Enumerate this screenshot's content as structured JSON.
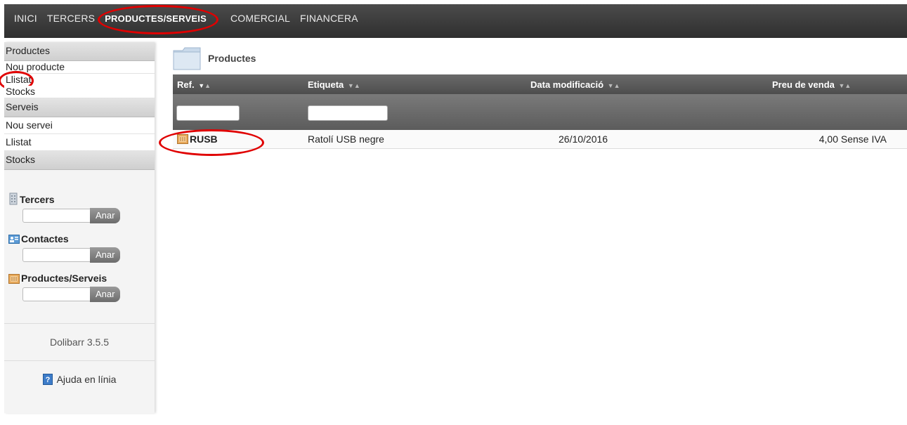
{
  "topmenu": {
    "items": [
      {
        "label": "INICI"
      },
      {
        "label": "TERCERS"
      },
      {
        "label": "PRODUCTES/SERVEIS"
      },
      {
        "label": "COMERCIAL"
      },
      {
        "label": "FINANCERA"
      }
    ],
    "active_index": 2
  },
  "sidebar": {
    "section_productes": "Productes",
    "nou_producte": "Nou producte",
    "llistat_productes": "Llistat",
    "stocks_link": "Stocks",
    "section_serveis": "Serveis",
    "nou_servei": "Nou servei",
    "llistat_serveis": "Llistat",
    "section_stocks": "Stocks",
    "search_tercers": {
      "title": "Tercers",
      "button": "Anar",
      "icon": "building-icon"
    },
    "search_contactes": {
      "title": "Contactes",
      "button": "Anar",
      "icon": "contact-card-icon"
    },
    "search_productes": {
      "title": "Productes/Serveis",
      "button": "Anar",
      "icon": "product-box-icon"
    },
    "version": "Dolibarr 3.5.5",
    "help": "Ajuda en línia"
  },
  "main": {
    "title": "Productes",
    "columns": [
      {
        "label": "Ref."
      },
      {
        "label": "Etiqueta"
      },
      {
        "label": "Data modificació"
      },
      {
        "label": "Preu de venda"
      }
    ],
    "rows": [
      {
        "ref": "RUSB",
        "label": "Ratolí USB negre",
        "date": "26/10/2016",
        "price": "4,00 Sense IVA"
      }
    ]
  },
  "colors": {
    "highlight": "#e00000",
    "topbar": "#3a3a3a"
  }
}
